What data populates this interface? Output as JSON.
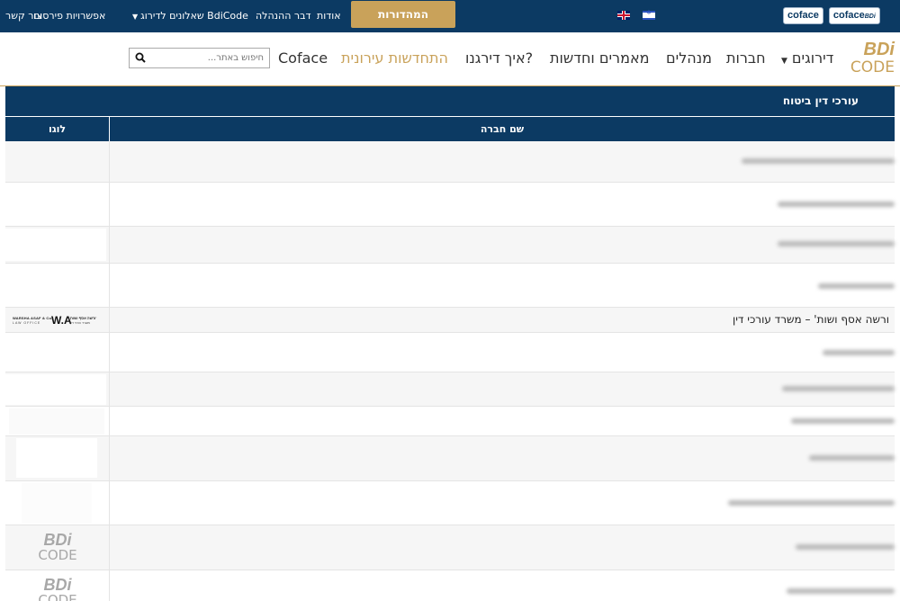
{
  "topbar": {
    "logos": [
      {
        "text": "coface",
        "suffix": ""
      },
      {
        "text": "coface",
        "suffix": "BDi"
      }
    ],
    "languages": [
      "english-flag",
      "hebrew-flag"
    ],
    "digital_button": "המהדורות הדיגיטליות",
    "nav": {
      "about": "אודות",
      "management": "דבר ההנהלה",
      "questionnaires": "שאלונים לדירוג BdiCode",
      "advertising": "אפשרויות פירסום",
      "contact": "צור קשר"
    }
  },
  "header": {
    "brand": {
      "line1": "BDi",
      "line2": "CODE"
    },
    "nav": {
      "ratings": "דירוגים",
      "companies": "חברות",
      "managers": "מנהלים",
      "articles": "מאמרים וחדשות",
      "how_rated": "איך דירגנו?",
      "urban": "התחדשות עירונית",
      "coface": "Coface"
    },
    "search": {
      "placeholder": "חיפוש באתר..."
    }
  },
  "table": {
    "title": "עורכי דין ביטוח",
    "columns": {
      "name": "שם חברה",
      "logo": "לוגו"
    },
    "rows": [
      {
        "name": "",
        "blurred": true
      },
      {
        "name": "",
        "blurred": true
      },
      {
        "name": "",
        "blurred": true
      },
      {
        "name": "",
        "blurred": true
      },
      {
        "name": "ורשה אסף ושות' – משרד עורכי דין",
        "blurred": false,
        "logo": {
          "en": "WARSHA ASAF & Co.",
          "en_sub": "LAW OFFICE",
          "mark": "W.A",
          "he": "ורשה אסף ושות'",
          "he_sub": "משרד עורכי דין"
        }
      },
      {
        "name": "",
        "blurred": true
      },
      {
        "name": "",
        "blurred": true
      },
      {
        "name": "",
        "blurred": true
      },
      {
        "name": "",
        "blurred": true
      },
      {
        "name": "",
        "blurred": true
      },
      {
        "name": "",
        "blurred": true,
        "logo": {
          "line1": "BDi",
          "line2": "CODE"
        }
      },
      {
        "name": "",
        "blurred": true,
        "logo": {
          "line1": "BDi",
          "line2": "CODE"
        }
      }
    ]
  }
}
